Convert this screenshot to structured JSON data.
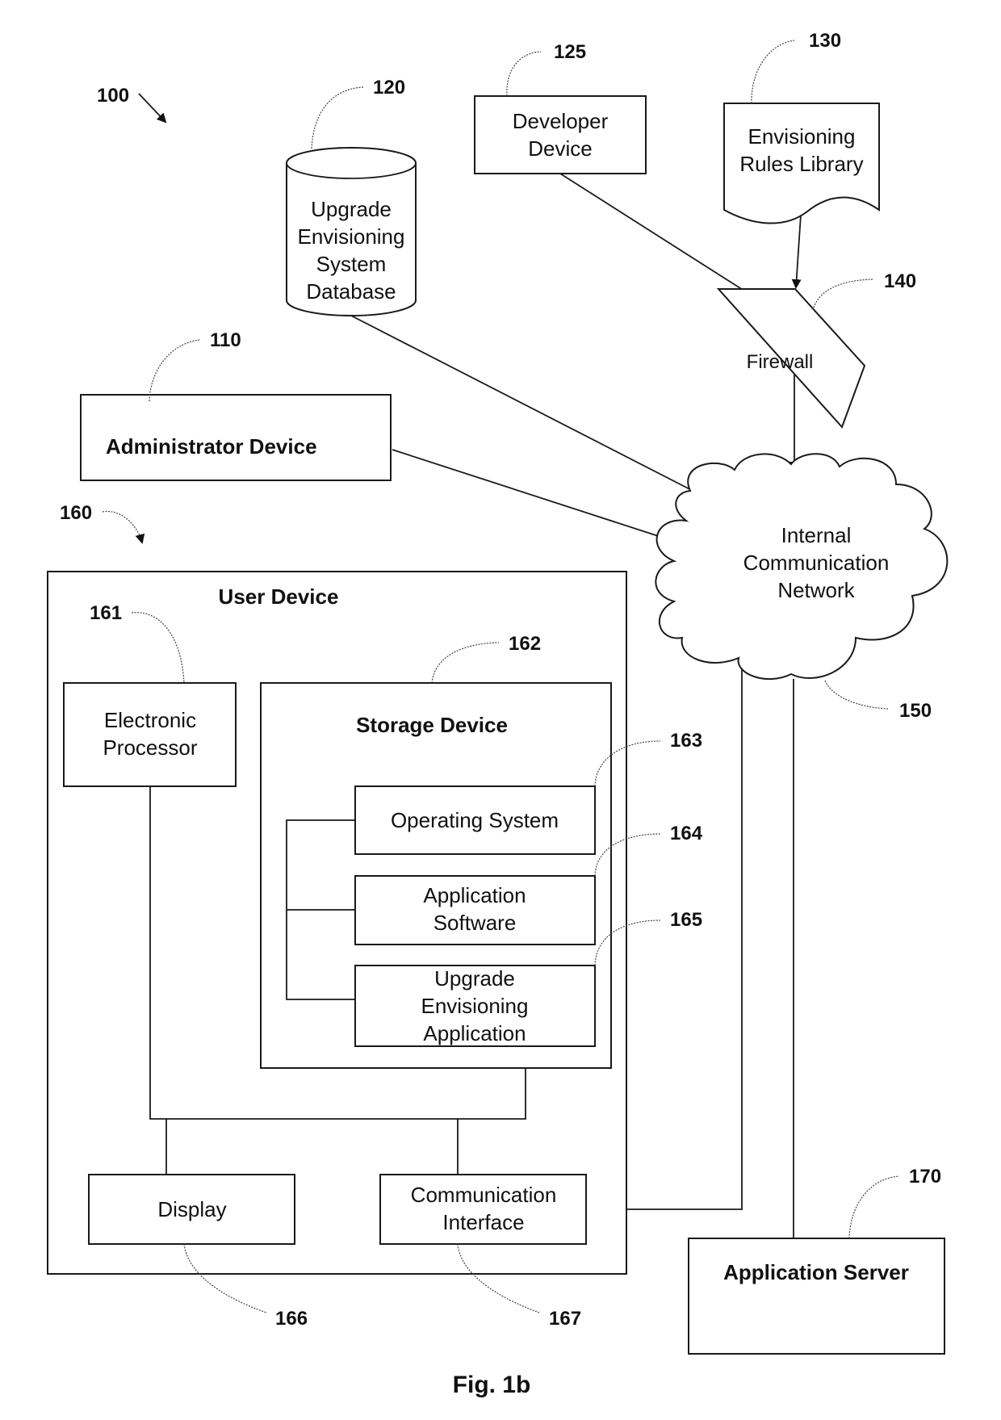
{
  "figure": {
    "caption": "Fig. 1b",
    "system_ref": "100"
  },
  "nodes": {
    "database": {
      "ref": "120",
      "lines": [
        "Upgrade",
        "Envisioning",
        "System",
        "Database"
      ]
    },
    "developer_device": {
      "ref": "125",
      "lines": [
        "Developer",
        "Device"
      ]
    },
    "rules_library": {
      "ref": "130",
      "lines": [
        "Envisioning",
        "Rules Library"
      ]
    },
    "firewall": {
      "ref": "140",
      "label": "Firewall"
    },
    "admin_device": {
      "ref": "110",
      "label": "Administrator Device"
    },
    "network": {
      "ref": "150",
      "lines": [
        "Internal",
        "Communication",
        "Network"
      ]
    },
    "user_device": {
      "ref": "160",
      "label": "User Device",
      "processor": {
        "ref": "161",
        "lines": [
          "Electronic",
          "Processor"
        ]
      },
      "storage": {
        "ref": "162",
        "label": "Storage Device",
        "operating_system": {
          "ref": "163",
          "lines": [
            "Operating System"
          ]
        },
        "application_software": {
          "ref": "164",
          "lines": [
            "Application",
            "Software"
          ]
        },
        "upgrade_app": {
          "ref": "165",
          "lines": [
            "Upgrade",
            "Envisioning",
            "Application"
          ]
        }
      },
      "display": {
        "ref": "166",
        "label": "Display"
      },
      "comm_interface": {
        "ref": "167",
        "lines": [
          "Communication",
          "Interface"
        ]
      }
    },
    "app_server": {
      "ref": "170",
      "label": "Application Server"
    }
  }
}
